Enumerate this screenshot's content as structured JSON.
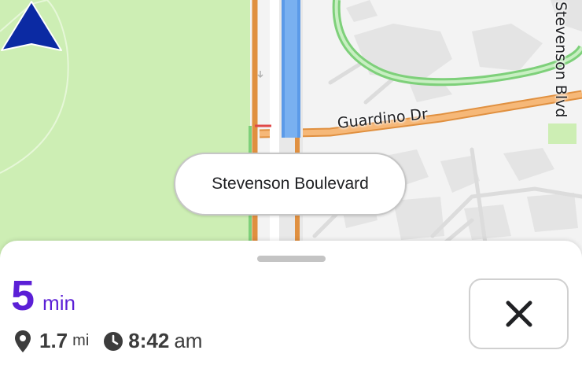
{
  "map": {
    "roads": {
      "vertical_road_label": "Stevenson Blvd",
      "cross_road_label": "Guardino Dr"
    },
    "current_street": "Stevenson Boulevard",
    "icons": {
      "position_marker": "navigation-arrow-icon"
    },
    "colors": {
      "park": "#cdeeb4",
      "route_highlight": "#5b9ae8",
      "arterial": "#f0a050",
      "green_path": "#7ed07a"
    }
  },
  "trip": {
    "eta_value": "5",
    "eta_unit": "min",
    "distance_value": "1.7",
    "distance_unit": "mi",
    "arrival_time": "8:42",
    "arrival_suffix": "am",
    "icons": {
      "distance": "location-pin-icon",
      "arrival": "clock-icon",
      "close": "close-icon"
    },
    "accent_color": "#5b1fd6"
  }
}
